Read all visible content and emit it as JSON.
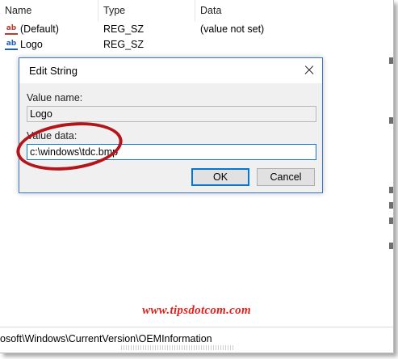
{
  "list": {
    "columns": [
      "Name",
      "Type",
      "Data"
    ],
    "rows": [
      {
        "icon": "string-value-icon",
        "name": "(Default)",
        "type": "REG_SZ",
        "data": "(value not set)"
      },
      {
        "icon": "string-value-icon",
        "name": "Logo",
        "type": "REG_SZ",
        "data": ""
      }
    ]
  },
  "dialog": {
    "title": "Edit String",
    "value_name_label": "Value name:",
    "value_name": "Logo",
    "value_data_label": "Value data:",
    "value_data": "c:\\windows\\tdc.bmp",
    "ok_label": "OK",
    "cancel_label": "Cancel"
  },
  "status_bar": {
    "path": "osoft\\Windows\\CurrentVersion\\OEMInformation"
  },
  "watermark": "www.tipsdotcom.com",
  "colors": {
    "accent": "#0078d7",
    "highlight_ring": "#b3151b",
    "watermark": "#e0201a"
  }
}
